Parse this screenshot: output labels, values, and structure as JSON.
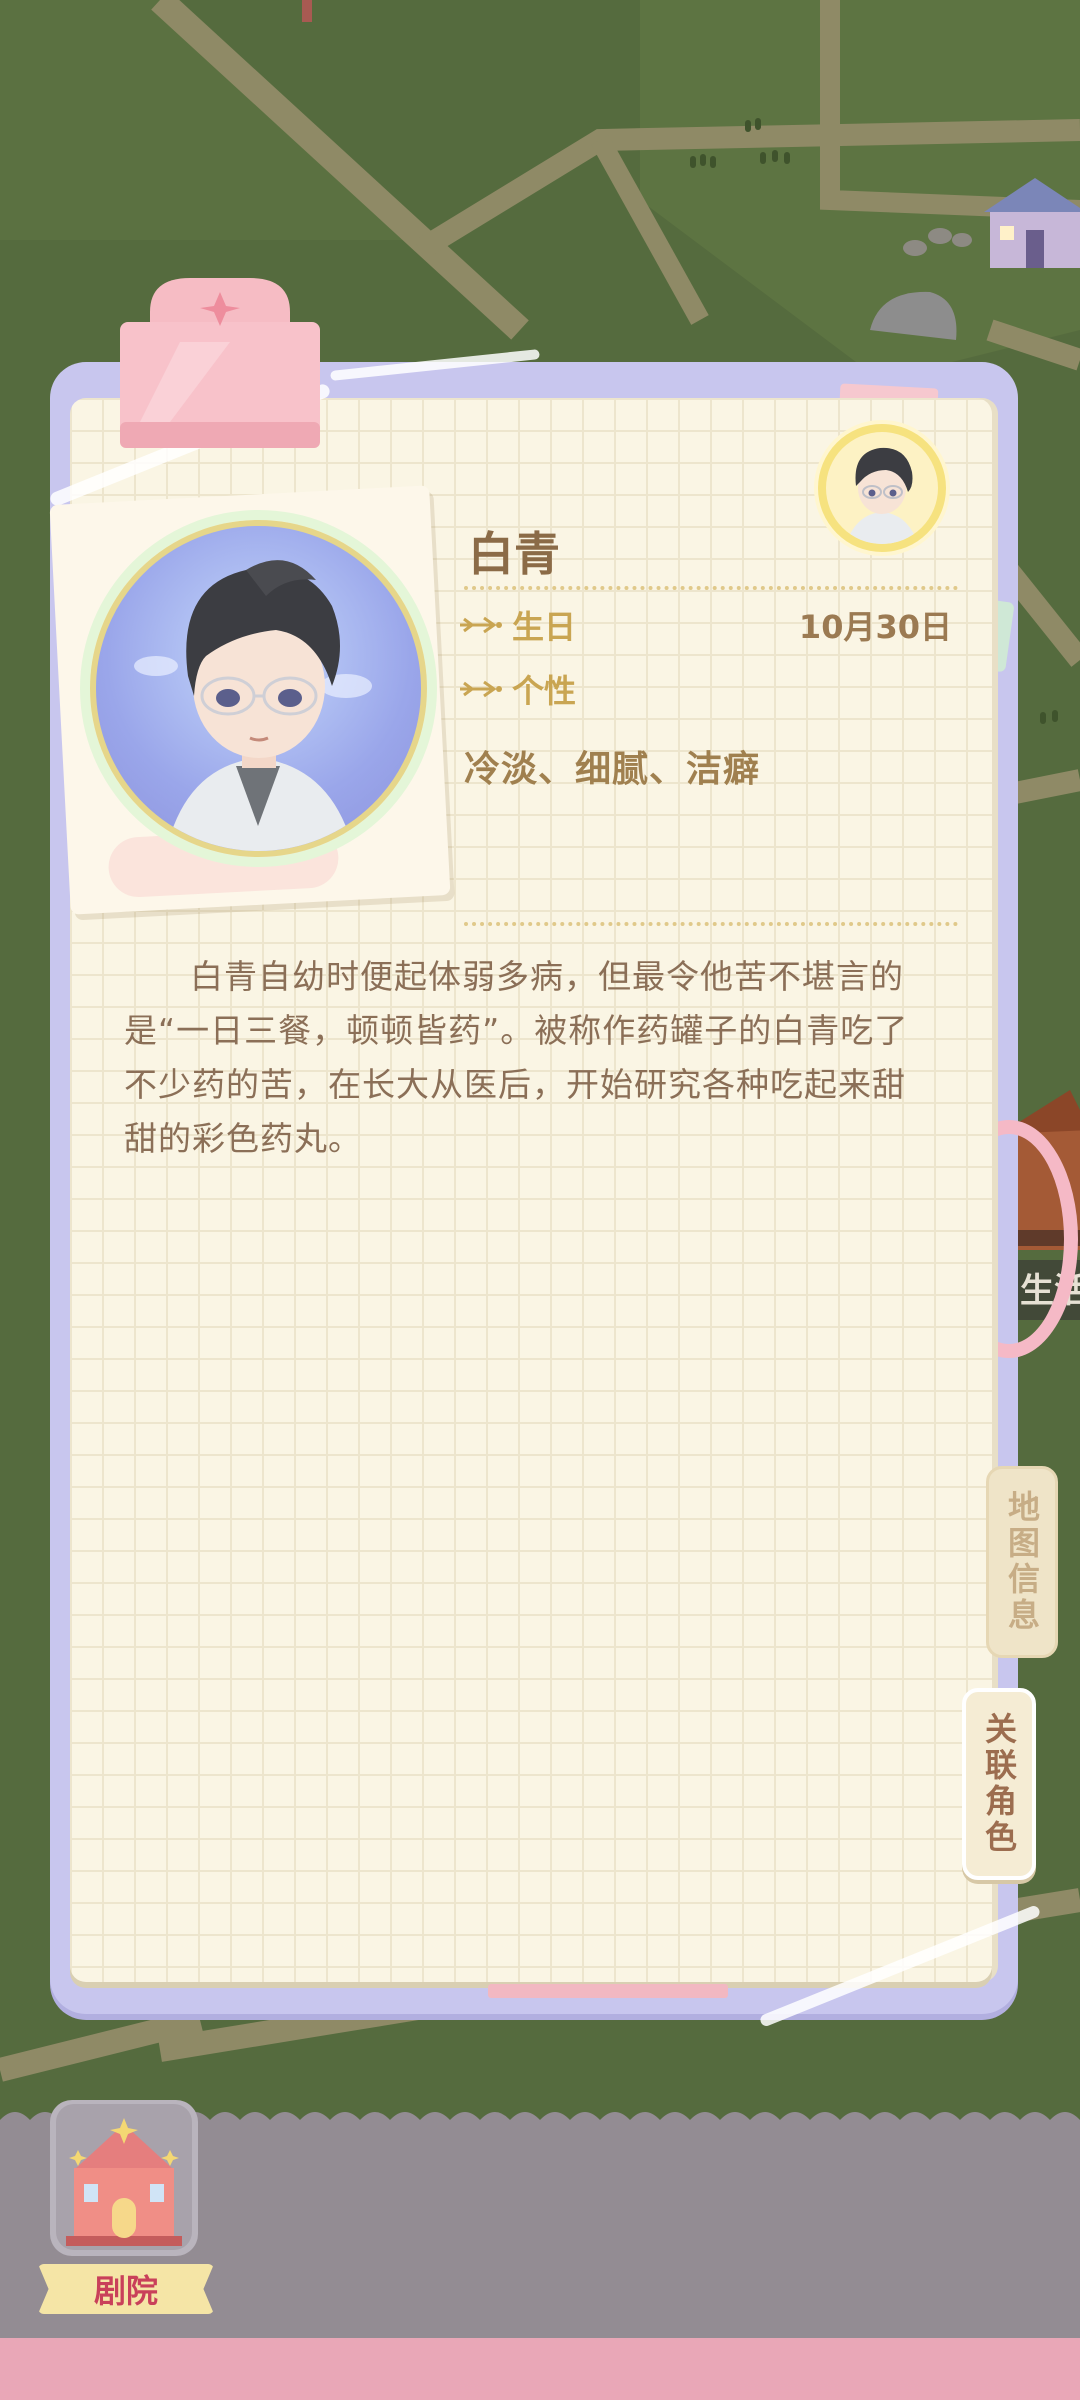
{
  "character": {
    "name": "白青",
    "birthday_label": "生日",
    "birthday_value": "10月30日",
    "personality_label": "个性",
    "traits": "冷淡、细腻、洁癖",
    "bio": "白青自幼时便起体弱多病，但最令他苦不堪言的是“一日三餐，顿顿皆药”。被称作药罐子的白青吃了不少药的苦，在长大从医后，开始研究各种吃起来甜甜的彩色药丸。"
  },
  "side_tabs": {
    "map_info": "地图信息",
    "related_roles": "关联角色"
  },
  "bottom": {
    "theater_label": "剧院"
  },
  "map_partial_label": "生活",
  "colors": {
    "map_green": "#556b3e",
    "road": "#8f8a66",
    "notebook_frame": "#c8c6ee",
    "page": "#faf5e4",
    "accent_gold": "#c9a552",
    "text_brown": "#8b6f57"
  }
}
